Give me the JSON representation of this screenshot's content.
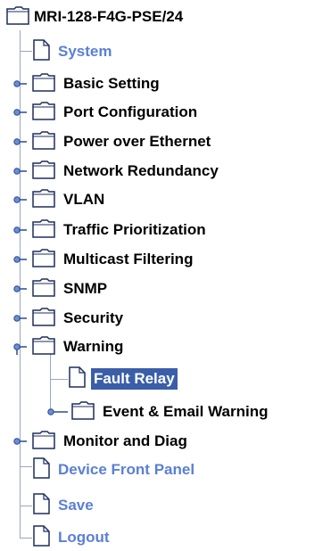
{
  "tree": {
    "root_label": "MRI-128-F4G-PSE/24",
    "items": [
      {
        "label": "System"
      },
      {
        "label": "Basic Setting"
      },
      {
        "label": "Port Configuration"
      },
      {
        "label": "Power over Ethernet"
      },
      {
        "label": "Network Redundancy"
      },
      {
        "label": "VLAN"
      },
      {
        "label": "Traffic Prioritization"
      },
      {
        "label": "Multicast Filtering"
      },
      {
        "label": "SNMP"
      },
      {
        "label": "Security"
      },
      {
        "label": "Warning"
      },
      {
        "label": "Fault Relay"
      },
      {
        "label": "Event & Email Warning"
      },
      {
        "label": "Monitor and Diag"
      },
      {
        "label": "Device Front Panel"
      },
      {
        "label": "Save"
      },
      {
        "label": "Logout"
      }
    ]
  },
  "colors": {
    "link": "#5a7fd6",
    "selected_bg": "#3b5ea8",
    "guide": "#9aa7c0"
  }
}
